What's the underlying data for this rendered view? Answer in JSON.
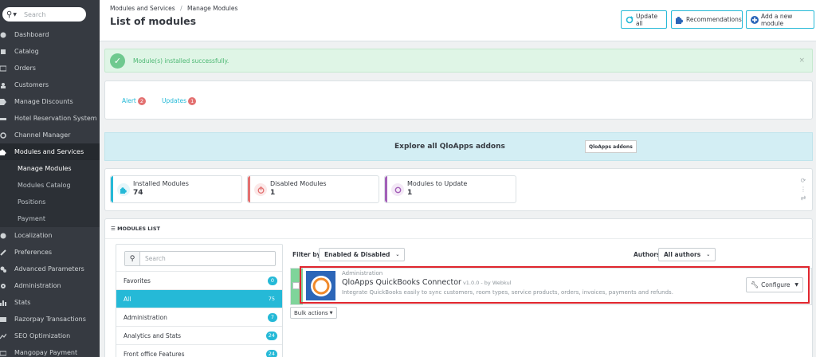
{
  "sidebar": {
    "search_placeholder": "Search",
    "items": [
      {
        "label": "Dashboard",
        "icon": "dashboard-icon"
      },
      {
        "label": "Catalog",
        "icon": "catalog-icon"
      },
      {
        "label": "Orders",
        "icon": "orders-icon"
      },
      {
        "label": "Customers",
        "icon": "customers-icon"
      },
      {
        "label": "Manage Discounts",
        "icon": "tag-icon"
      },
      {
        "label": "Hotel Reservation System",
        "icon": "bed-icon"
      },
      {
        "label": "Channel Manager",
        "icon": "refresh-icon"
      },
      {
        "label": "Modules and Services",
        "icon": "puzzle-icon"
      },
      {
        "label": "Localization",
        "icon": "globe-icon"
      },
      {
        "label": "Preferences",
        "icon": "wrench-icon"
      },
      {
        "label": "Advanced Parameters",
        "icon": "cogs-icon"
      },
      {
        "label": "Administration",
        "icon": "gear-icon"
      },
      {
        "label": "Stats",
        "icon": "bar-chart-icon"
      },
      {
        "label": "Razorpay Transactions",
        "icon": "card-icon"
      },
      {
        "label": "SEO Optimization",
        "icon": "line-chart-icon"
      },
      {
        "label": "Mangopay Payment",
        "icon": "money-icon"
      }
    ],
    "subitems": [
      "Manage Modules",
      "Modules Catalog",
      "Positions",
      "Payment"
    ]
  },
  "header": {
    "breadcrumb_parent": "Modules and Services",
    "breadcrumb_sep": "/",
    "breadcrumb_current": "Manage Modules",
    "title": "List of modules",
    "btn_update_all": "Update all",
    "btn_recommendations": "Recommendations",
    "btn_add_module": "Add a new module"
  },
  "alert": {
    "message": "Module(s) installed successfully.",
    "close": "×"
  },
  "tabs": {
    "alert_label": "Alert",
    "alert_count": "2",
    "updates_label": "Updates",
    "updates_count": "1"
  },
  "explore": {
    "text": "Explore all QloApps addons",
    "button": "QloApps addons"
  },
  "kpis": [
    {
      "title": "Installed Modules",
      "value": "74",
      "color": "#25b9d7"
    },
    {
      "title": "Disabled Modules",
      "value": "1",
      "color": "#e37070"
    },
    {
      "title": "Modules to Update",
      "value": "1",
      "color": "#a35fb8"
    }
  ],
  "modules_list": {
    "heading": "MODULES LIST",
    "search_placeholder": "Search",
    "categories": [
      {
        "label": "Favorites",
        "count": "0"
      },
      {
        "label": "All",
        "count": "75"
      },
      {
        "label": "Administration",
        "count": "7"
      },
      {
        "label": "Analytics and Stats",
        "count": "24"
      },
      {
        "label": "Front office Features",
        "count": "24"
      }
    ],
    "filter_by_label": "Filter by",
    "filter_value": "Enabled & Disabled",
    "authors_label": "Authors",
    "authors_value": "All authors",
    "bulk_actions": "Bulk actions"
  },
  "module": {
    "category": "Administration",
    "name": "QloApps QuickBooks Connector",
    "version": "v1.0.0 - by Webkul",
    "description": "Integrate QuickBooks easily to sync customers, room types, service products, orders, invoices, payments and refunds.",
    "configure": "Configure"
  }
}
